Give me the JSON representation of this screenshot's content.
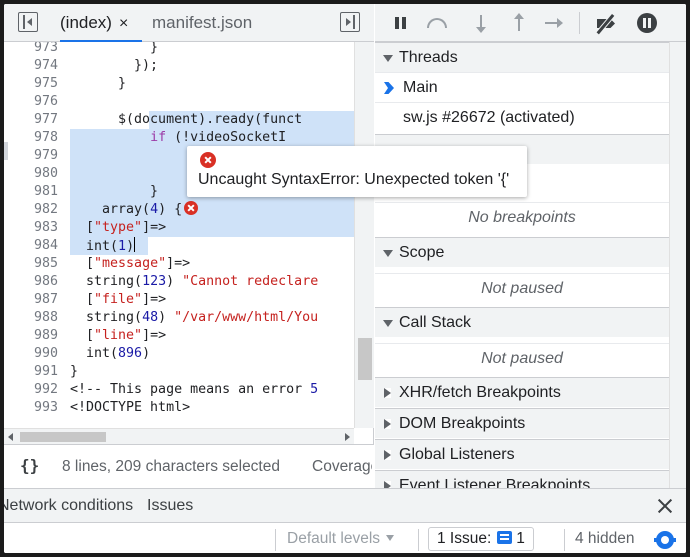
{
  "editor": {
    "tabs": [
      {
        "label": "(index)",
        "close": "×"
      },
      {
        "label": "manifest.json"
      }
    ],
    "lines": [
      {
        "n": "973",
        "t": "          }"
      },
      {
        "n": "974",
        "t": "        });"
      },
      {
        "n": "975",
        "t": "      }"
      },
      {
        "n": "976",
        "t": ""
      },
      {
        "n": "977",
        "t": "      $(document).ready(funct"
      },
      {
        "n": "978",
        "t": "          if (!videoSocketI"
      },
      {
        "n": "979",
        "t": ""
      },
      {
        "n": "980",
        "t": ""
      },
      {
        "n": "981",
        "t": "          }"
      },
      {
        "n": "982",
        "t": "    array(4) {"
      },
      {
        "n": "983",
        "t": "  [\"type\"]=>"
      },
      {
        "n": "984",
        "t": "  int(1)"
      },
      {
        "n": "985",
        "t": "  [\"message\"]=>"
      },
      {
        "n": "986",
        "t": "  string(123) \"Cannot redeclare"
      },
      {
        "n": "987",
        "t": "  [\"file\"]=>"
      },
      {
        "n": "988",
        "t": "  string(48) \"/var/www/html/You"
      },
      {
        "n": "989",
        "t": "  [\"line\"]=>"
      },
      {
        "n": "990",
        "t": "  int(896)"
      },
      {
        "n": "991",
        "t": "}"
      },
      {
        "n": "992",
        "t": "<!-- This page means an error 5"
      },
      {
        "n": "993",
        "t": "<!DOCTYPE html>"
      }
    ],
    "error_popup": "Uncaught SyntaxError: Unexpected token '{'",
    "status": {
      "braces": "{}",
      "selection": "8 lines, 209 characters selected",
      "coverage": "Coverage"
    }
  },
  "debugger": {
    "sections": {
      "threads": "Threads",
      "breakpoints_empty": "No breakpoints",
      "scope": "Scope",
      "scope_empty": "Not paused",
      "callstack": "Call Stack",
      "callstack_empty": "Not paused",
      "xhr": "XHR/fetch Breakpoints",
      "dom": "DOM Breakpoints",
      "global": "Global Listeners",
      "event": "Event Listener Breakpoints"
    },
    "threads": [
      {
        "label": "Main",
        "current": true
      },
      {
        "label": "sw.js #26672 (activated)"
      }
    ]
  },
  "drawer": {
    "tabs": [
      "Network conditions",
      "Issues"
    ],
    "console": {
      "levels": "Default levels",
      "issue_label": "1 Issue:",
      "issue_count": "1",
      "hidden": "4 hidden"
    }
  },
  "colors": {
    "accent": "#1a73e8",
    "error": "#d93025",
    "selection": "#cfe2f8",
    "keyword": "#9b3aa6",
    "string": "#c5221f",
    "number": "#1a1aa6"
  }
}
